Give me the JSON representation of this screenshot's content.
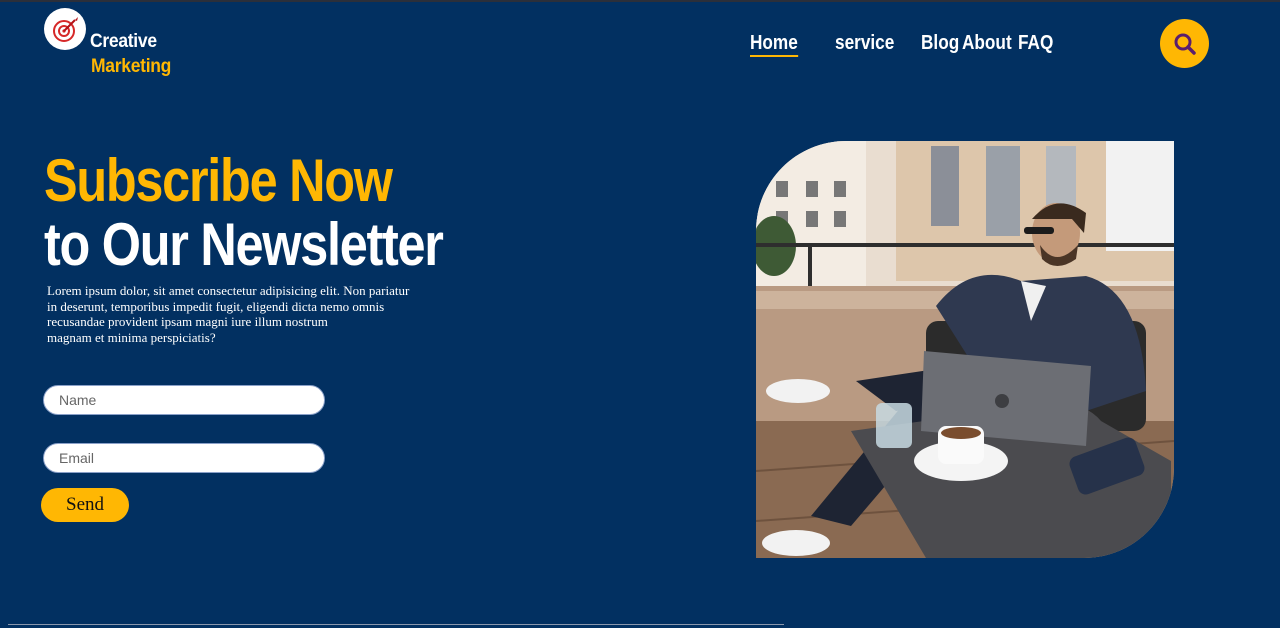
{
  "brand": {
    "line1": "Creative",
    "line2": "Marketing"
  },
  "nav": [
    {
      "label": "Home",
      "active": true
    },
    {
      "label": "service",
      "active": false
    },
    {
      "label": "Blog",
      "active": false
    },
    {
      "label": "About",
      "active": false
    },
    {
      "label": "FAQ",
      "active": false
    }
  ],
  "icons": {
    "logo": "dart-target-icon",
    "search": "search-icon"
  },
  "hero": {
    "headline_accent": "Subscribe Now",
    "headline_main": "to Our Newsletter",
    "description_lines": [
      "Lorem ipsum dolor, sit amet consectetur adipisicing elit. Non pariatur",
      "in deserunt, temporibus impedit fugit, eligendi dicta nemo omnis",
      "recusandae provident ipsam magni iure illum nostrum",
      "magnam et minima perspiciatis?"
    ]
  },
  "form": {
    "name_placeholder": "Name",
    "email_placeholder": "Email",
    "send_label": "Send"
  },
  "colors": {
    "background": "#023061",
    "accent": "#ffb703",
    "text": "#ffffff"
  }
}
